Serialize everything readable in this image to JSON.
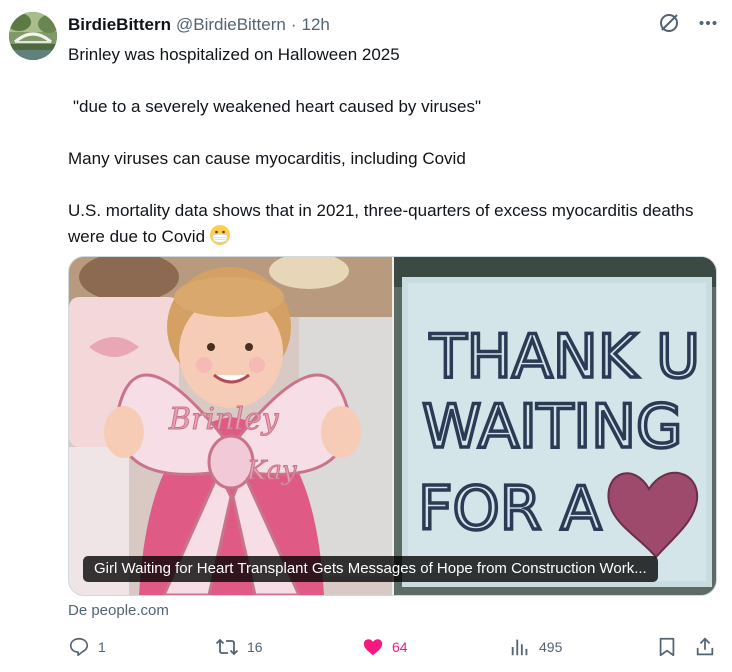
{
  "author": {
    "display_name": "BirdieBittern",
    "handle": "@BirdieBittern",
    "separator": "·",
    "time": "12h"
  },
  "header_icons": [
    "grok-icon",
    "more-icon"
  ],
  "tweet": {
    "paragraphs": [
      "Brinley was hospitalized on Halloween 2025",
      "\"due to a severely weakened heart caused by viruses\"",
      "Many viruses can cause myocarditis, including Covid",
      "U.S. mortality data shows that in 2021, three-quarters of excess myocarditis deaths were due to Covid"
    ]
  },
  "card": {
    "title": "Girl Waiting for Heart Transplant Gets Messages of Hope from Construction Work...",
    "left_image": {
      "bow_text_1": "Brinley",
      "bow_text_2": "Kay"
    },
    "right_image": {
      "sign_line_1": "THANK U",
      "sign_line_2": "WAITING",
      "sign_line_3": "FOR A"
    },
    "source": "De people.com"
  },
  "actions": {
    "replies": "1",
    "reposts": "16",
    "likes": "64",
    "views": "495"
  },
  "colors": {
    "like_pink": "#f91880",
    "text_secondary": "#536471",
    "text_primary": "#0f1419"
  }
}
